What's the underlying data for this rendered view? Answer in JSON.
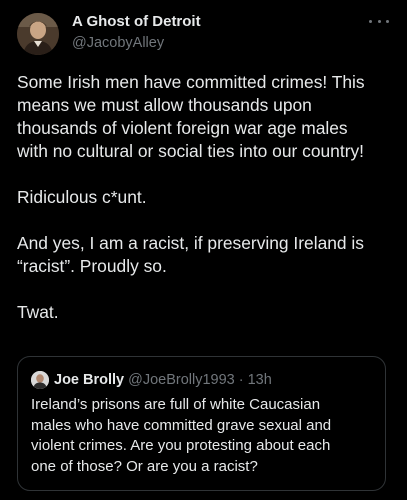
{
  "post": {
    "author": {
      "display_name": "A Ghost of Detroit",
      "handle": "@JacobyAlley"
    },
    "more_icon": "more-horizontal-icon",
    "paragraphs": [
      "Some Irish men have committed crimes! This\nmeans we must allow thousands upon\nthousands of violent foreign war age males\nwith no cultural or social ties into our country!",
      "Ridiculous c*unt.",
      "And yes, I am a racist, if preserving Ireland is\n“racist”. Proudly so.",
      "Twat."
    ]
  },
  "quote": {
    "display_name": "Joe Brolly",
    "handle": "@JoeBrolly1993",
    "separator": "·",
    "time": "13h",
    "text": "Ireland’s prisons are full of white Caucasian\nmales who have committed grave sexual and\nviolent crimes. Are you protesting about each\none of those? Or are you a racist?"
  },
  "colors": {
    "background": "#000000",
    "primary_text": "#e7e9ea",
    "secondary_text": "#71767b",
    "border": "#2f3336"
  }
}
